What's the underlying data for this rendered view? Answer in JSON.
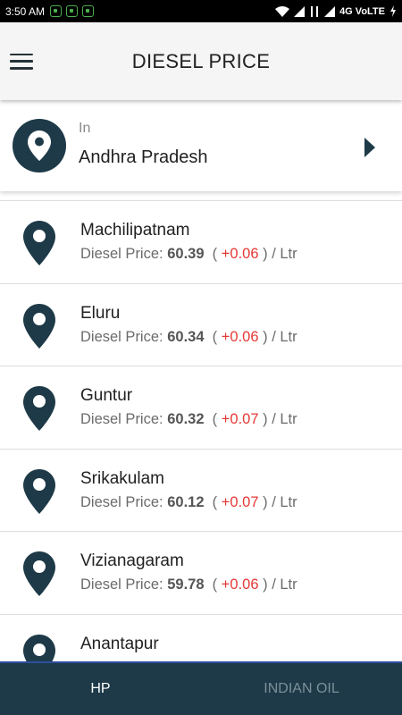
{
  "status_bar": {
    "time": "3:50 AM",
    "network": "4G VoLTE",
    "icons": [
      "notification-icon",
      "notification-icon",
      "notification-icon",
      "wifi-icon",
      "signal-icon",
      "data-signal-icon",
      "signal-icon",
      "battery-charging-icon"
    ]
  },
  "app_bar": {
    "menu_icon": "hamburger-menu-icon",
    "title": "DIESEL PRICE"
  },
  "state_selector": {
    "prefix": "In",
    "state": "Andhra Pradesh",
    "icon": "location-pin-icon",
    "arrow_icon": "arrow-right-icon"
  },
  "list": {
    "price_label": "Diesel Price:",
    "unit": "/ Ltr",
    "items": [
      {
        "city": "Machilipatnam",
        "price": "60.39",
        "change": "+0.06"
      },
      {
        "city": "Eluru",
        "price": "60.34",
        "change": "+0.06"
      },
      {
        "city": "Guntur",
        "price": "60.32",
        "change": "+0.07"
      },
      {
        "city": "Srikakulam",
        "price": "60.12",
        "change": "+0.07"
      },
      {
        "city": "Vizianagaram",
        "price": "59.78",
        "change": "+0.06"
      },
      {
        "city": "Anantapur",
        "price": "",
        "change": ""
      }
    ]
  },
  "bottom_nav": {
    "tabs": [
      {
        "label": "HP",
        "active": true
      },
      {
        "label": "INDIAN OIL",
        "active": false
      }
    ]
  },
  "colors": {
    "primary_dark": "#1e3a48",
    "change_red": "#e53935",
    "app_bar_bg": "#f5f5f5"
  }
}
